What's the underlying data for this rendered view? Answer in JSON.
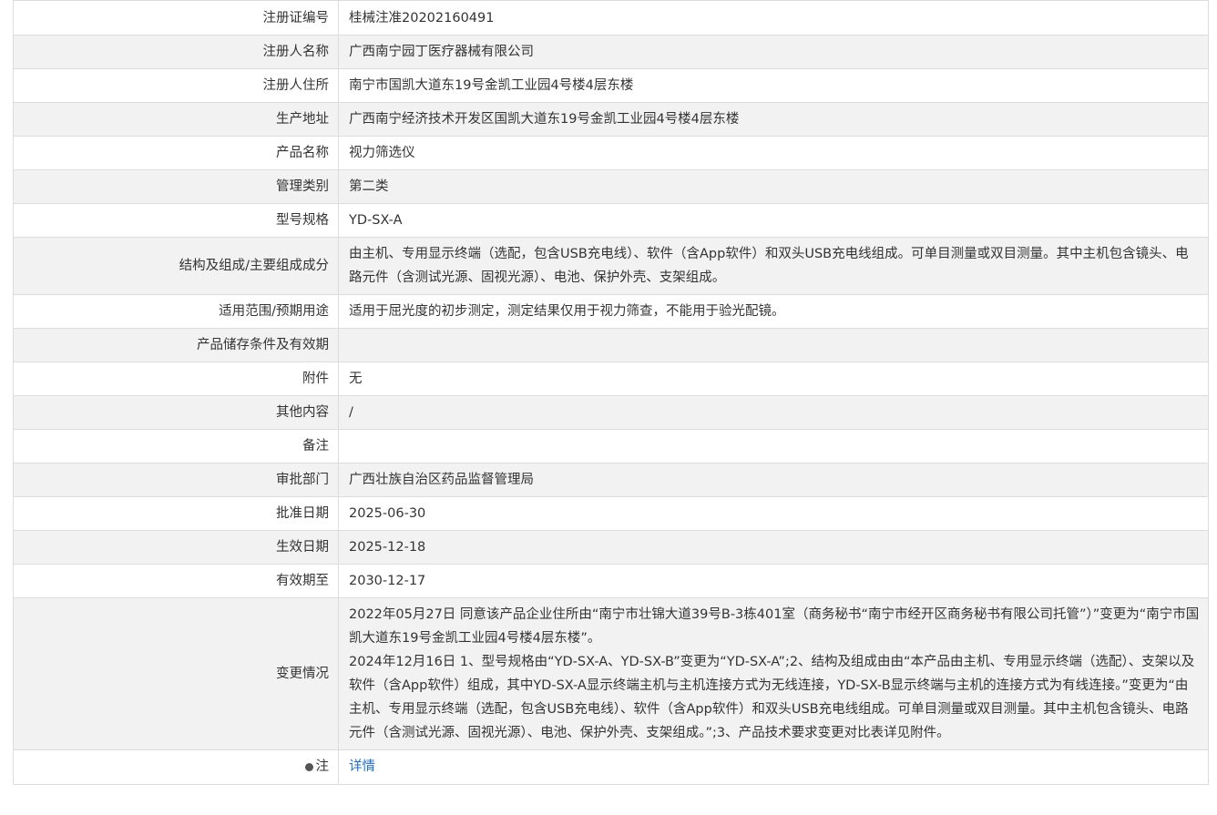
{
  "rows": [
    {
      "label": "注册证编号",
      "value": "桂械注准20202160491"
    },
    {
      "label": "注册人名称",
      "value": "广西南宁园丁医疗器械有限公司"
    },
    {
      "label": "注册人住所",
      "value": "南宁市国凯大道东19号金凯工业园4号楼4层东楼"
    },
    {
      "label": "生产地址",
      "value": "广西南宁经济技术开发区国凯大道东19号金凯工业园4号楼4层东楼"
    },
    {
      "label": "产品名称",
      "value": "视力筛选仪"
    },
    {
      "label": "管理类别",
      "value": "第二类"
    },
    {
      "label": "型号规格",
      "value": "YD-SX-A"
    },
    {
      "label": "结构及组成/主要组成成分",
      "value": "由主机、专用显示终端（选配，包含USB充电线）、软件（含App软件）和双头USB充电线组成。可单目测量或双目测量。其中主机包含镜头、电路元件（含测试光源、固视光源）、电池、保护外壳、支架组成。"
    },
    {
      "label": "适用范围/预期用途",
      "value": "适用于屈光度的初步测定，测定结果仅用于视力筛查，不能用于验光配镜。"
    },
    {
      "label": "产品储存条件及有效期",
      "value": ""
    },
    {
      "label": "附件",
      "value": "无"
    },
    {
      "label": "其他内容",
      "value": "/"
    },
    {
      "label": "备注",
      "value": ""
    },
    {
      "label": "审批部门",
      "value": "广西壮族自治区药品监督管理局"
    },
    {
      "label": "批准日期",
      "value": "2025-06-30"
    },
    {
      "label": "生效日期",
      "value": "2025-12-18"
    },
    {
      "label": "有效期至",
      "value": "2030-12-17"
    }
  ],
  "changes": {
    "label": "变更情况",
    "entries": [
      "2022年05月27日 同意该产品企业住所由“南宁市壮锦大道39号B-3栋401室（商务秘书“南宁市经开区商务秘书有限公司托管”）”变更为“南宁市国凯大道东19号金凯工业园4号楼4层东楼”。",
      "2024年12月16日 1、型号规格由“YD-SX-A、YD-SX-B”变更为“YD-SX-A”;2、结构及组成由由“本产品由主机、专用显示终端（选配）、支架以及软件（含App软件）组成，其中YD-SX-A显示终端主机与主机连接方式为无线连接，YD-SX-B显示终端与主机的连接方式为有线连接。”变更为“由主机、专用显示终端（选配，包含USB充电线）、软件（含App软件）和双头USB充电线组成。可单目测量或双目测量。其中主机包含镜头、电路元件（含测试光源、固视光源）、电池、保护外壳、支架组成。”;3、产品技术要求变更对比表详见附件。"
    ]
  },
  "note": {
    "label": "注",
    "link": "详情",
    "icon": "dot-icon"
  }
}
